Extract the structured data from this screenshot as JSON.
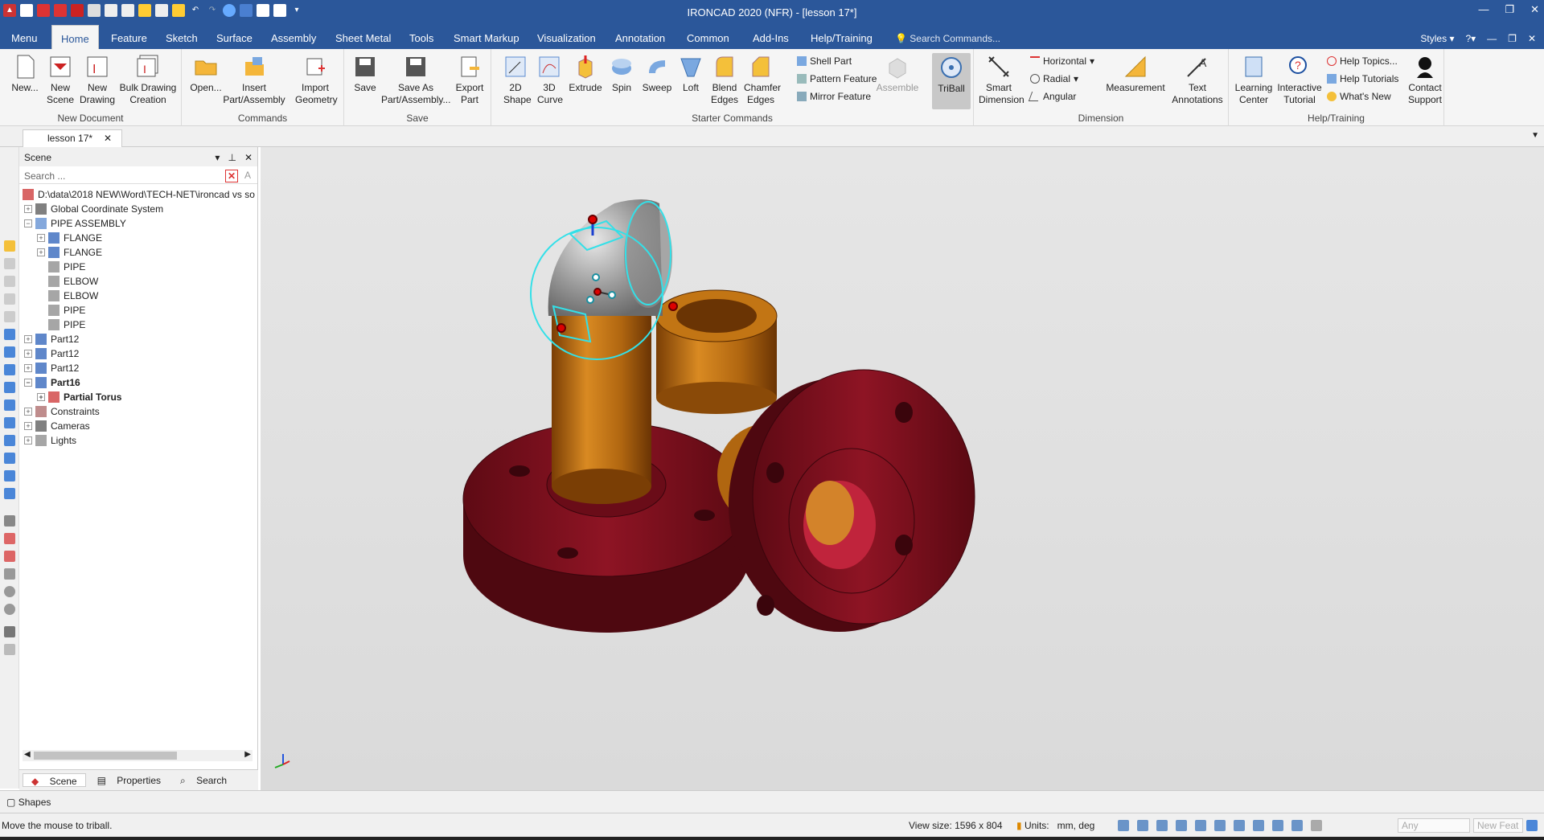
{
  "window": {
    "title": "IRONCAD 2020 (NFR) - [lesson 17*]"
  },
  "menu_tabs": [
    "Menu",
    "Home",
    "Feature",
    "Sketch",
    "Surface",
    "Assembly",
    "Sheet Metal",
    "Tools",
    "Smart Markup",
    "Visualization",
    "Annotation",
    "Common",
    "Add-Ins",
    "Help/Training"
  ],
  "search_commands": "Search Commands...",
  "styles_label": "Styles",
  "ribbon": {
    "new_document": {
      "label": "New Document",
      "buttons": [
        "New...",
        "New Scene",
        "New Drawing",
        "Bulk Drawing Creation"
      ]
    },
    "commands": {
      "label": "Commands",
      "buttons": [
        "Open...",
        "Insert Part/Assembly",
        "Import Geometry"
      ]
    },
    "save": {
      "label": "Save",
      "buttons": [
        "Save",
        "Save As Part/Assembly...",
        "Export Part"
      ]
    },
    "starter": {
      "label": "Starter Commands",
      "buttons": [
        "2D Shape",
        "3D Curve",
        "Extrude",
        "Spin",
        "Sweep",
        "Loft",
        "Blend Edges",
        "Chamfer Edges"
      ],
      "small": [
        "Shell Part",
        "Pattern Feature",
        "Mirror Feature"
      ],
      "assemble": "Assemble",
      "triball": "TriBall"
    },
    "dimension": {
      "label": "Dimension",
      "smart": "Smart Dimension",
      "small": [
        "Horizontal",
        "Radial",
        "Angular"
      ],
      "measurement": "Measurement",
      "text": "Text Annotations"
    },
    "help": {
      "label": "Help/Training",
      "buttons": [
        "Learning Center",
        "Interactive Tutorial"
      ],
      "small": [
        "Help Topics...",
        "Help Tutorials",
        "What's New"
      ],
      "contact": "Contact Support"
    }
  },
  "doc_tab": "lesson 17*",
  "scene_panel": {
    "title": "Scene",
    "search_placeholder": "Search ...",
    "tree": [
      {
        "label": "D:\\data\\2018 NEW\\Word\\TECH-NET\\ironcad vs so",
        "level": 0,
        "exp": ""
      },
      {
        "label": "Global Coordinate System",
        "level": 0,
        "exp": "+"
      },
      {
        "label": "PIPE ASSEMBLY",
        "level": 0,
        "exp": "-"
      },
      {
        "label": "FLANGE",
        "level": 1,
        "exp": "+"
      },
      {
        "label": "FLANGE",
        "level": 1,
        "exp": "+"
      },
      {
        "label": "PIPE",
        "level": 1,
        "exp": ""
      },
      {
        "label": "ELBOW",
        "level": 1,
        "exp": ""
      },
      {
        "label": "ELBOW",
        "level": 1,
        "exp": ""
      },
      {
        "label": "PIPE",
        "level": 1,
        "exp": ""
      },
      {
        "label": "PIPE",
        "level": 1,
        "exp": ""
      },
      {
        "label": "Part12",
        "level": 0,
        "exp": "+"
      },
      {
        "label": "Part12",
        "level": 0,
        "exp": "+"
      },
      {
        "label": "Part12",
        "level": 0,
        "exp": "+"
      },
      {
        "label": "Part16",
        "level": 0,
        "exp": "-",
        "bold": true
      },
      {
        "label": "Partial Torus",
        "level": 1,
        "exp": "+",
        "bold": true
      },
      {
        "label": "Constraints",
        "level": 0,
        "exp": "+"
      },
      {
        "label": "Cameras",
        "level": 0,
        "exp": "+"
      },
      {
        "label": "Lights",
        "level": 0,
        "exp": "+"
      }
    ],
    "tabs": [
      "Scene",
      "Properties",
      "Search"
    ]
  },
  "shapes_bar": "Shapes",
  "status": {
    "message": "Move the mouse to triball.",
    "view_size": "View size: 1596 x  804",
    "units_label": "Units:",
    "units_value": "mm, deg",
    "any": "Any",
    "new_feat": "New Feat"
  },
  "colors": {
    "accent": "#2b579a",
    "flange": "#7a0f1c",
    "pipe": "#b86a12",
    "triball": "#33e0e8"
  }
}
